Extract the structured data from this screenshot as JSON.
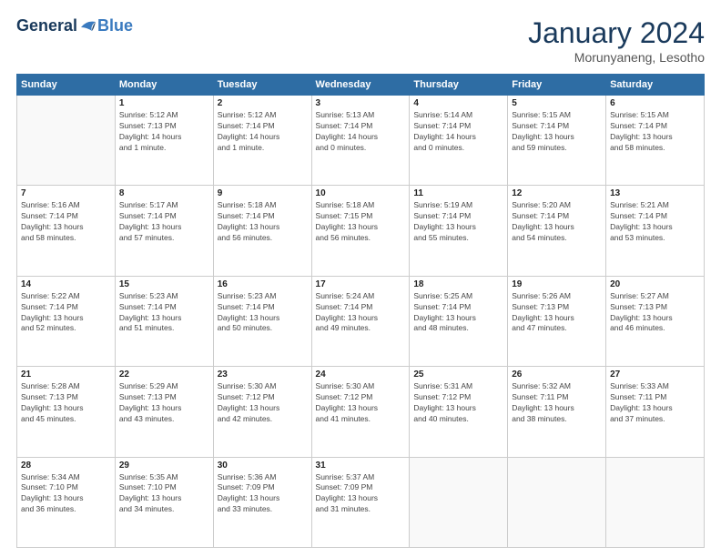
{
  "header": {
    "logo_general": "General",
    "logo_blue": "Blue",
    "month_title": "January 2024",
    "location": "Morunyaneng, Lesotho"
  },
  "weekdays": [
    "Sunday",
    "Monday",
    "Tuesday",
    "Wednesday",
    "Thursday",
    "Friday",
    "Saturday"
  ],
  "weeks": [
    [
      {
        "day": "",
        "info": ""
      },
      {
        "day": "1",
        "info": "Sunrise: 5:12 AM\nSunset: 7:13 PM\nDaylight: 14 hours\nand 1 minute."
      },
      {
        "day": "2",
        "info": "Sunrise: 5:12 AM\nSunset: 7:14 PM\nDaylight: 14 hours\nand 1 minute."
      },
      {
        "day": "3",
        "info": "Sunrise: 5:13 AM\nSunset: 7:14 PM\nDaylight: 14 hours\nand 0 minutes."
      },
      {
        "day": "4",
        "info": "Sunrise: 5:14 AM\nSunset: 7:14 PM\nDaylight: 14 hours\nand 0 minutes."
      },
      {
        "day": "5",
        "info": "Sunrise: 5:15 AM\nSunset: 7:14 PM\nDaylight: 13 hours\nand 59 minutes."
      },
      {
        "day": "6",
        "info": "Sunrise: 5:15 AM\nSunset: 7:14 PM\nDaylight: 13 hours\nand 58 minutes."
      }
    ],
    [
      {
        "day": "7",
        "info": "Sunrise: 5:16 AM\nSunset: 7:14 PM\nDaylight: 13 hours\nand 58 minutes."
      },
      {
        "day": "8",
        "info": "Sunrise: 5:17 AM\nSunset: 7:14 PM\nDaylight: 13 hours\nand 57 minutes."
      },
      {
        "day": "9",
        "info": "Sunrise: 5:18 AM\nSunset: 7:14 PM\nDaylight: 13 hours\nand 56 minutes."
      },
      {
        "day": "10",
        "info": "Sunrise: 5:18 AM\nSunset: 7:15 PM\nDaylight: 13 hours\nand 56 minutes."
      },
      {
        "day": "11",
        "info": "Sunrise: 5:19 AM\nSunset: 7:14 PM\nDaylight: 13 hours\nand 55 minutes."
      },
      {
        "day": "12",
        "info": "Sunrise: 5:20 AM\nSunset: 7:14 PM\nDaylight: 13 hours\nand 54 minutes."
      },
      {
        "day": "13",
        "info": "Sunrise: 5:21 AM\nSunset: 7:14 PM\nDaylight: 13 hours\nand 53 minutes."
      }
    ],
    [
      {
        "day": "14",
        "info": "Sunrise: 5:22 AM\nSunset: 7:14 PM\nDaylight: 13 hours\nand 52 minutes."
      },
      {
        "day": "15",
        "info": "Sunrise: 5:23 AM\nSunset: 7:14 PM\nDaylight: 13 hours\nand 51 minutes."
      },
      {
        "day": "16",
        "info": "Sunrise: 5:23 AM\nSunset: 7:14 PM\nDaylight: 13 hours\nand 50 minutes."
      },
      {
        "day": "17",
        "info": "Sunrise: 5:24 AM\nSunset: 7:14 PM\nDaylight: 13 hours\nand 49 minutes."
      },
      {
        "day": "18",
        "info": "Sunrise: 5:25 AM\nSunset: 7:14 PM\nDaylight: 13 hours\nand 48 minutes."
      },
      {
        "day": "19",
        "info": "Sunrise: 5:26 AM\nSunset: 7:13 PM\nDaylight: 13 hours\nand 47 minutes."
      },
      {
        "day": "20",
        "info": "Sunrise: 5:27 AM\nSunset: 7:13 PM\nDaylight: 13 hours\nand 46 minutes."
      }
    ],
    [
      {
        "day": "21",
        "info": "Sunrise: 5:28 AM\nSunset: 7:13 PM\nDaylight: 13 hours\nand 45 minutes."
      },
      {
        "day": "22",
        "info": "Sunrise: 5:29 AM\nSunset: 7:13 PM\nDaylight: 13 hours\nand 43 minutes."
      },
      {
        "day": "23",
        "info": "Sunrise: 5:30 AM\nSunset: 7:12 PM\nDaylight: 13 hours\nand 42 minutes."
      },
      {
        "day": "24",
        "info": "Sunrise: 5:30 AM\nSunset: 7:12 PM\nDaylight: 13 hours\nand 41 minutes."
      },
      {
        "day": "25",
        "info": "Sunrise: 5:31 AM\nSunset: 7:12 PM\nDaylight: 13 hours\nand 40 minutes."
      },
      {
        "day": "26",
        "info": "Sunrise: 5:32 AM\nSunset: 7:11 PM\nDaylight: 13 hours\nand 38 minutes."
      },
      {
        "day": "27",
        "info": "Sunrise: 5:33 AM\nSunset: 7:11 PM\nDaylight: 13 hours\nand 37 minutes."
      }
    ],
    [
      {
        "day": "28",
        "info": "Sunrise: 5:34 AM\nSunset: 7:10 PM\nDaylight: 13 hours\nand 36 minutes."
      },
      {
        "day": "29",
        "info": "Sunrise: 5:35 AM\nSunset: 7:10 PM\nDaylight: 13 hours\nand 34 minutes."
      },
      {
        "day": "30",
        "info": "Sunrise: 5:36 AM\nSunset: 7:09 PM\nDaylight: 13 hours\nand 33 minutes."
      },
      {
        "day": "31",
        "info": "Sunrise: 5:37 AM\nSunset: 7:09 PM\nDaylight: 13 hours\nand 31 minutes."
      },
      {
        "day": "",
        "info": ""
      },
      {
        "day": "",
        "info": ""
      },
      {
        "day": "",
        "info": ""
      }
    ]
  ]
}
